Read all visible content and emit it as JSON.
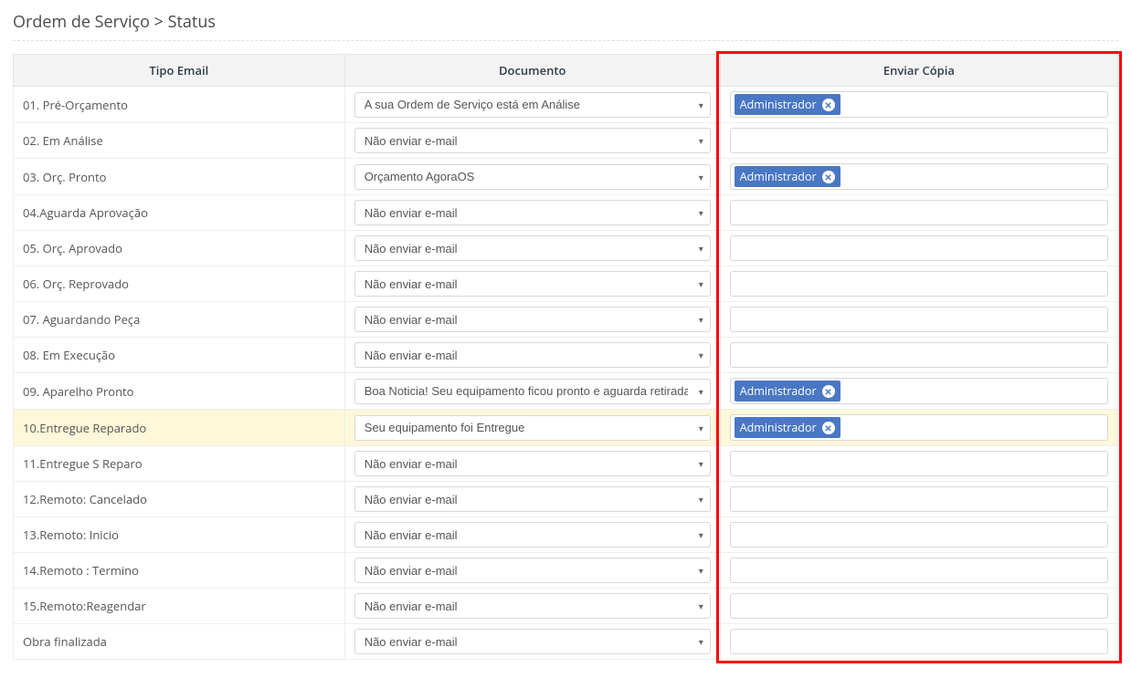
{
  "breadcrumb": {
    "section": "Ordem de Serviço",
    "separator": ">",
    "page": "Status"
  },
  "table": {
    "headers": {
      "email_type": "Tipo Email",
      "document": "Documento",
      "send_copy": "Enviar Cópia"
    },
    "tag_label": "Administrador",
    "rows": [
      {
        "email_type": "01. Pré-Orçamento",
        "document": "A sua Ordem de Serviço está em Análise",
        "tags": [
          "Administrador"
        ],
        "highlight": false
      },
      {
        "email_type": "02. Em Análise",
        "document": "Não enviar e-mail",
        "tags": [],
        "highlight": false
      },
      {
        "email_type": "03. Orç. Pronto",
        "document": "Orçamento AgoraOS",
        "tags": [
          "Administrador"
        ],
        "highlight": false
      },
      {
        "email_type": "04.Aguarda Aprovação",
        "document": "Não enviar e-mail",
        "tags": [],
        "highlight": false
      },
      {
        "email_type": "05. Orç. Aprovado",
        "document": "Não enviar e-mail",
        "tags": [],
        "highlight": false
      },
      {
        "email_type": "06. Orç. Reprovado",
        "document": "Não enviar e-mail",
        "tags": [],
        "highlight": false
      },
      {
        "email_type": "07. Aguardando Peça",
        "document": "Não enviar e-mail",
        "tags": [],
        "highlight": false
      },
      {
        "email_type": "08. Em Execução",
        "document": "Não enviar e-mail",
        "tags": [],
        "highlight": false
      },
      {
        "email_type": "09. Aparelho Pronto",
        "document": "Boa Noticia! Seu equipamento ficou pronto e aguarda retirada",
        "tags": [
          "Administrador"
        ],
        "highlight": false
      },
      {
        "email_type": "10.Entregue Reparado",
        "document": "Seu equipamento foi Entregue",
        "tags": [
          "Administrador"
        ],
        "highlight": true
      },
      {
        "email_type": "11.Entregue S Reparo",
        "document": "Não enviar e-mail",
        "tags": [],
        "highlight": false
      },
      {
        "email_type": "12.Remoto: Cancelado",
        "document": "Não enviar e-mail",
        "tags": [],
        "highlight": false
      },
      {
        "email_type": "13.Remoto: Inicio",
        "document": "Não enviar e-mail",
        "tags": [],
        "highlight": false
      },
      {
        "email_type": "14.Remoto : Termino",
        "document": "Não enviar e-mail",
        "tags": [],
        "highlight": false
      },
      {
        "email_type": "15.Remoto:Reagendar",
        "document": "Não enviar e-mail",
        "tags": [],
        "highlight": false
      },
      {
        "email_type": "Obra finalizada",
        "document": "Não enviar e-mail",
        "tags": [],
        "highlight": false
      }
    ]
  }
}
